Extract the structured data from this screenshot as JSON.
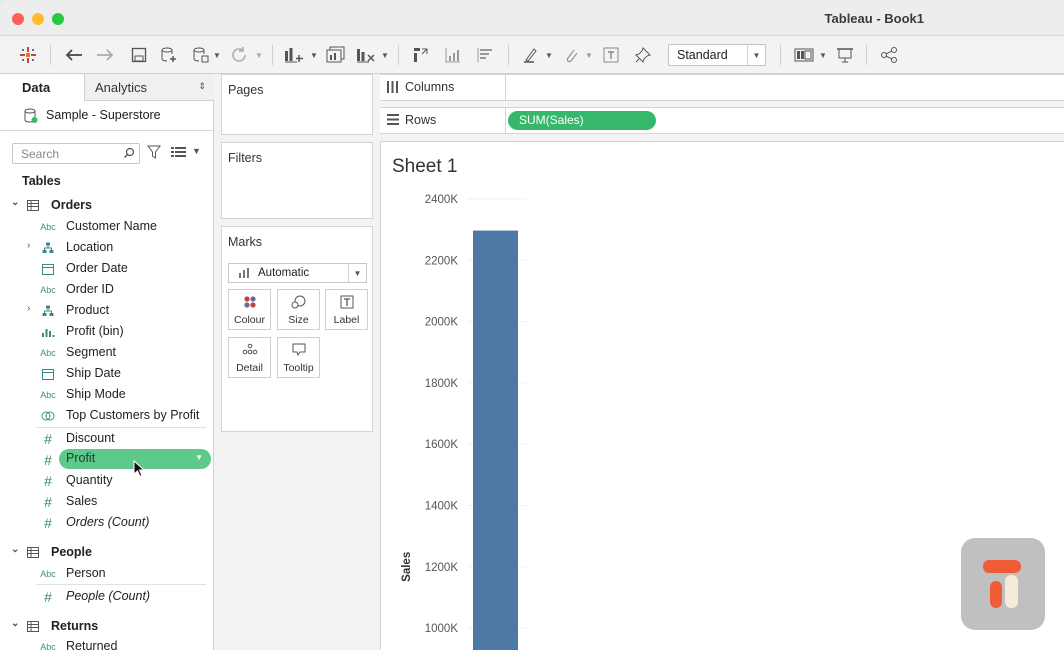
{
  "window": {
    "title": "Tableau - Book1"
  },
  "toolbar": {
    "fit_mode": "Standard"
  },
  "data_pane": {
    "tabs": {
      "data": "Data",
      "analytics": "Analytics"
    },
    "data_source": "Sample - Superstore",
    "search_placeholder": "Search",
    "tables_heading": "Tables",
    "groups": {
      "orders": {
        "name": "Orders",
        "fields": [
          {
            "label": "Customer Name",
            "type": "Abc"
          },
          {
            "label": "Location",
            "type": "hierarchy"
          },
          {
            "label": "Order Date",
            "type": "date"
          },
          {
            "label": "Order ID",
            "type": "Abc"
          },
          {
            "label": "Product",
            "type": "hierarchy"
          },
          {
            "label": "Profit (bin)",
            "type": "bin"
          },
          {
            "label": "Segment",
            "type": "Abc"
          },
          {
            "label": "Ship Date",
            "type": "date"
          },
          {
            "label": "Ship Mode",
            "type": "Abc"
          },
          {
            "label": "Top Customers by Profit",
            "type": "set"
          }
        ],
        "measures": [
          {
            "label": "Discount",
            "type": "#"
          },
          {
            "label": "Profit",
            "type": "#"
          },
          {
            "label": "Quantity",
            "type": "#"
          },
          {
            "label": "Sales",
            "type": "#"
          },
          {
            "label": "Orders (Count)",
            "type": "#"
          }
        ]
      },
      "people": {
        "name": "People",
        "fields": [
          {
            "label": "Person",
            "type": "Abc"
          }
        ],
        "measures": [
          {
            "label": "People (Count)",
            "type": "#"
          }
        ]
      },
      "returns": {
        "name": "Returns",
        "fields": [
          {
            "label": "Returned",
            "type": "Abc"
          }
        ]
      }
    }
  },
  "shelves": {
    "pages": "Pages",
    "filters": "Filters",
    "marks": {
      "title": "Marks",
      "type": "Automatic",
      "buttons": {
        "colour": "Colour",
        "size": "Size",
        "label": "Label",
        "detail": "Detail",
        "tooltip": "Tooltip"
      }
    },
    "columns": "Columns",
    "rows": "Rows",
    "rows_pill": "SUM(Sales)"
  },
  "sheet": {
    "title": "Sheet 1"
  },
  "chart_data": {
    "type": "bar",
    "categories": [
      ""
    ],
    "values": [
      2297000
    ],
    "ylabel": "Sales",
    "ylim_visible": [
      850000,
      2450000
    ],
    "y_ticks": [
      "2400K",
      "2200K",
      "2000K",
      "1800K",
      "1600K",
      "1400K",
      "1200K",
      "1000K"
    ],
    "y_tick_values": [
      2400000,
      2200000,
      2000000,
      1800000,
      1600000,
      1400000,
      1200000,
      1000000
    ],
    "bar_color": "#4e79a7"
  },
  "colors": {
    "pill_green": "#35b86c",
    "selected_pill": "#5ec98b",
    "bar": "#4e79a7"
  }
}
